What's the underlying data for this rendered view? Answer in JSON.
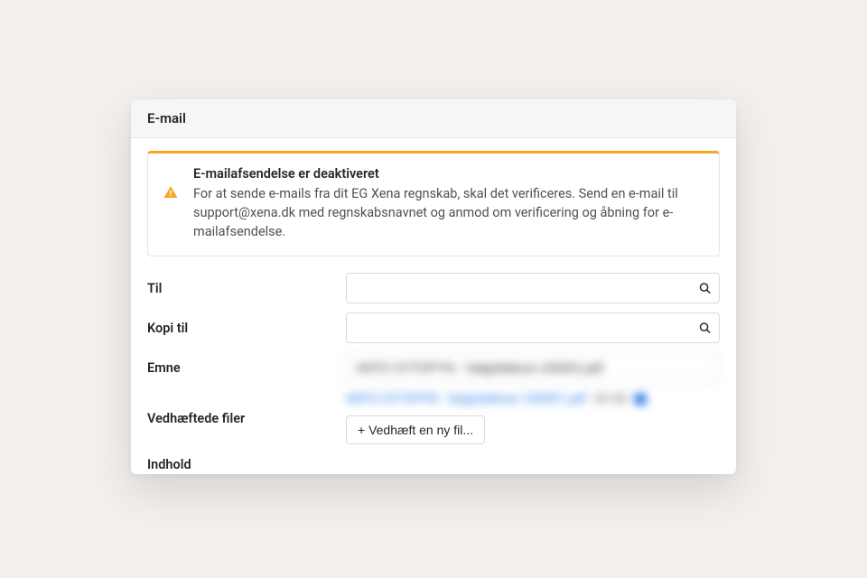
{
  "header": {
    "title": "E-mail"
  },
  "alert": {
    "title": "E-mailafsendelse er deaktiveret",
    "body": "For at sende e-mails fra dit EG Xena regnskab, skal det verificeres. Send en e-mail til support@xena.dk med regnskabsnavnet og anmod om verificering og åbning for e-mailafsendelse."
  },
  "labels": {
    "to": "Til",
    "cc": "Kopi til",
    "subject": "Emne",
    "attachments": "Vedhæftede filer",
    "content": "Indhold"
  },
  "fields": {
    "to_value": "",
    "cc_value": "",
    "subject_value": "ANTO SYTOPYN - Salgsfaktura 100001.pdf"
  },
  "attachment": {
    "name": "ANTO SYTOPYN - Salgsfaktura 100001.pdf",
    "size": "48 KB"
  },
  "buttons": {
    "attach_new": "+ Vedhæft en ny fil..."
  }
}
